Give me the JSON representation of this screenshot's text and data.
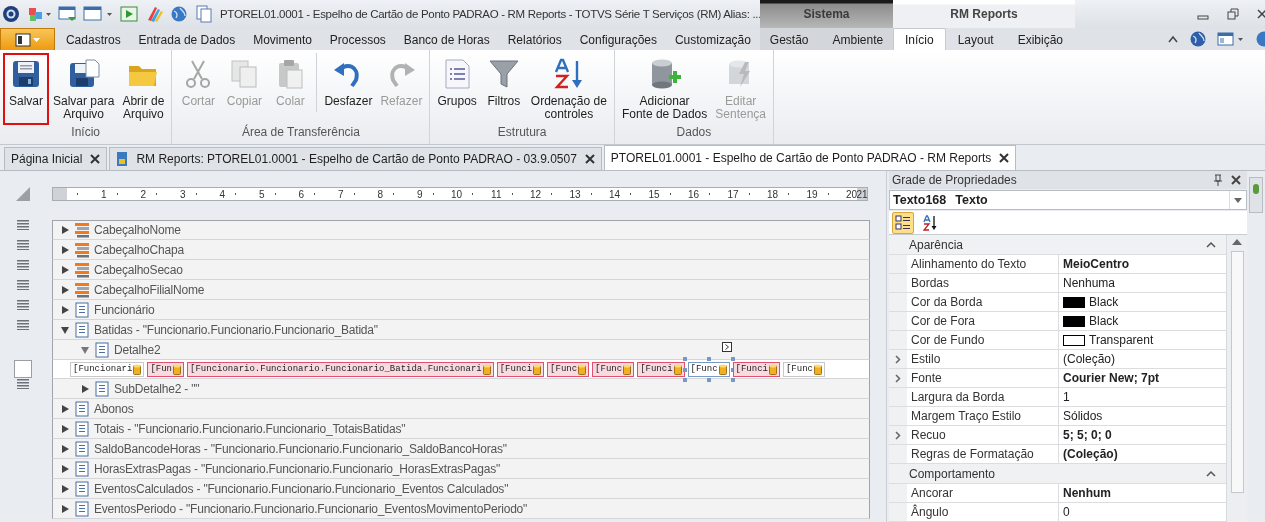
{
  "window": {
    "title": "PTOREL01.0001 - Espelho de Cartão de Ponto PADRAO - RM Reports - TOTVS Série T Serviços (RM) Alias: ..."
  },
  "ribbon": {
    "tabs": [
      {
        "label": "Cadastros",
        "selected": false
      },
      {
        "label": "Entrada de Dados",
        "selected": false
      },
      {
        "label": "Movimento",
        "selected": false
      },
      {
        "label": "Processos",
        "selected": false
      },
      {
        "label": "Banco de Horas",
        "selected": false
      },
      {
        "label": "Relatórios",
        "selected": false
      },
      {
        "label": "Configurações",
        "selected": false
      },
      {
        "label": "Customização",
        "selected": false
      }
    ],
    "context_groups": [
      {
        "title": "Sistema",
        "kind": "dark",
        "tabs": [
          {
            "label": "Gestão",
            "selected": false
          },
          {
            "label": "Ambiente",
            "selected": false
          }
        ]
      },
      {
        "title": "RM Reports",
        "kind": "light",
        "tabs": [
          {
            "label": "Início",
            "selected": true
          },
          {
            "label": "Layout",
            "selected": false
          },
          {
            "label": "Exibição",
            "selected": false
          }
        ]
      }
    ],
    "groups": [
      {
        "label": "Início",
        "sections": [
          [
            {
              "label": "Salvar",
              "disabled": false,
              "highlighted": true
            },
            {
              "label": "Salvar para\nArquivo",
              "disabled": false,
              "highlighted": false
            },
            {
              "label": "Abrir de\nArquivo",
              "disabled": false,
              "highlighted": false
            }
          ]
        ]
      },
      {
        "label": "Área de Transferência",
        "sections": [
          [
            {
              "label": "Cortar",
              "disabled": true,
              "highlighted": false
            },
            {
              "label": "Copiar",
              "disabled": true,
              "highlighted": false
            },
            {
              "label": "Colar",
              "disabled": true,
              "highlighted": false
            }
          ],
          [
            {
              "label": "Desfazer",
              "disabled": false,
              "highlighted": false
            },
            {
              "label": "Refazer",
              "disabled": true,
              "highlighted": false
            }
          ]
        ]
      },
      {
        "label": "Estrutura",
        "sections": [
          [
            {
              "label": "Grupos",
              "disabled": false,
              "highlighted": false
            },
            {
              "label": "Filtros",
              "disabled": false,
              "highlighted": false
            },
            {
              "label": "Ordenação de\ncontroles",
              "disabled": false,
              "highlighted": false
            }
          ]
        ]
      },
      {
        "label": "Dados",
        "sections": [
          [
            {
              "label": "Adicionar\nFonte de Dados",
              "disabled": false,
              "highlighted": false
            },
            {
              "label": "Editar\nSentença",
              "disabled": true,
              "highlighted": false
            }
          ]
        ]
      }
    ]
  },
  "doc_tabs": [
    {
      "label": "Página Inicial",
      "selected": false
    },
    {
      "label": "RM Reports: PTOREL01.0001 - Espelho de Cartão de Ponto PADRAO - 03.9.0507",
      "selected": false
    },
    {
      "label": "PTOREL01.0001 - Espelho de Cartão de Ponto PADRAO - RM Reports",
      "selected": true
    }
  ],
  "ruler": [
    "1",
    "2",
    "3",
    "4",
    "5",
    "6",
    "7",
    "8",
    "9",
    "10",
    "11",
    "12",
    "13",
    "14",
    "15",
    "16",
    "17",
    "18",
    "19",
    "20",
    "21"
  ],
  "bands": [
    {
      "kind": "header",
      "label": "CabeçalhoNome",
      "expanded": false,
      "handle": true
    },
    {
      "kind": "header",
      "label": "CabeçalhoChapa",
      "expanded": false,
      "handle": true
    },
    {
      "kind": "header",
      "label": "CabeçalhoSecao",
      "expanded": false,
      "handle": true
    },
    {
      "kind": "header",
      "label": "CabeçalhoFilialNome",
      "expanded": false,
      "handle": true
    },
    {
      "kind": "band",
      "label": "Funcionário",
      "expanded": false,
      "handle": true
    },
    {
      "kind": "band",
      "label": "Batidas - \"Funcionario.Funcionario.Funcionario_Batida\"",
      "expanded": true,
      "handle": true,
      "children": [
        {
          "kind": "band",
          "label": "Detalhe2",
          "expanded": true,
          "handle": false,
          "controls": [
            {
              "text": "[Funcionari",
              "flagged": false,
              "selected": false
            },
            {
              "text": "[Fun",
              "flagged": true,
              "selected": false
            },
            {
              "text": "[Funcionario.Funcionario.Funcionario_Batida.Funcionari",
              "flagged": true,
              "selected": false
            },
            {
              "text": "[Funci",
              "flagged": true,
              "selected": false
            },
            {
              "text": "[Func",
              "flagged": true,
              "selected": false
            },
            {
              "text": "[Func",
              "flagged": true,
              "selected": false
            },
            {
              "text": "[Funci",
              "flagged": true,
              "selected": false
            },
            {
              "text": "[Func",
              "flagged": false,
              "selected": true
            },
            {
              "text": "[Funci",
              "flagged": true,
              "selected": false
            },
            {
              "text": "[Func",
              "flagged": false,
              "selected": false
            }
          ]
        },
        {
          "kind": "band",
          "label": "SubDetalhe2 - \"\"",
          "expanded": false,
          "handle": true
        }
      ]
    },
    {
      "kind": "band",
      "label": "Abonos",
      "expanded": false,
      "handle": false
    },
    {
      "kind": "band",
      "label": "Totais - \"Funcionario.Funcionario.Funcionario_TotaisBatidas\"",
      "expanded": false,
      "handle": false
    },
    {
      "kind": "band",
      "label": "SaldoBancodeHoras - \"Funcionario.Funcionario.Funcionario_SaldoBancoHoras\"",
      "expanded": false,
      "handle": false
    },
    {
      "kind": "band",
      "label": "HorasExtrasPagas - \"Funcionario.Funcionario.Funcionario_HorasExtrasPagas\"",
      "expanded": false,
      "handle": false
    },
    {
      "kind": "band",
      "label": "EventosCalculados - \"Funcionario.Funcionario.Funcionario_Eventos Calculados\"",
      "expanded": false,
      "handle": false
    },
    {
      "kind": "band",
      "label": "EventosPeriodo - \"Funcionario.Funcionario.Funcionario_EventosMovimentoPeriodo\"",
      "expanded": false,
      "handle": false
    }
  ],
  "properties": {
    "title": "Grade de Propriedades",
    "object_name": "Texto168",
    "object_type": "Texto",
    "view_buttons": [
      {
        "selected": true
      },
      {
        "selected": false
      }
    ],
    "categories": [
      {
        "label": "Aparência",
        "expanded": true,
        "rows": [
          {
            "name": "Alinhamento do Texto",
            "value": "MeioCentro",
            "modified": true,
            "expandable": false
          },
          {
            "name": "Bordas",
            "value": "Nenhuma",
            "modified": false,
            "expandable": false
          },
          {
            "name": "Cor da Borda",
            "value": "Black",
            "modified": false,
            "expandable": false,
            "color": "#000000"
          },
          {
            "name": "Cor de Fora",
            "value": "Black",
            "modified": false,
            "expandable": false,
            "color": "#000000"
          },
          {
            "name": "Cor de Fundo",
            "value": "Transparent",
            "modified": false,
            "expandable": false,
            "color": "#ffffff"
          },
          {
            "name": "Estilo",
            "value": "(Coleção)",
            "modified": false,
            "expandable": true
          },
          {
            "name": "Fonte",
            "value": "Courier New; 7pt",
            "modified": true,
            "expandable": true
          },
          {
            "name": "Largura da Borda",
            "value": "1",
            "modified": false,
            "expandable": false
          },
          {
            "name": "Margem Traço Estilo",
            "value": "Sólidos",
            "modified": false,
            "expandable": false
          },
          {
            "name": "Recuo",
            "value": "5; 5; 0; 0",
            "modified": true,
            "expandable": true
          },
          {
            "name": "Regras de Formatação",
            "value": "(Coleção)",
            "modified": true,
            "expandable": false
          }
        ]
      },
      {
        "label": "Comportamento",
        "expanded": true,
        "rows": [
          {
            "name": "Ancorar",
            "value": "Nenhum",
            "modified": true,
            "expandable": false
          },
          {
            "name": "Ângulo",
            "value": "0",
            "modified": false,
            "expandable": false
          }
        ]
      }
    ]
  }
}
